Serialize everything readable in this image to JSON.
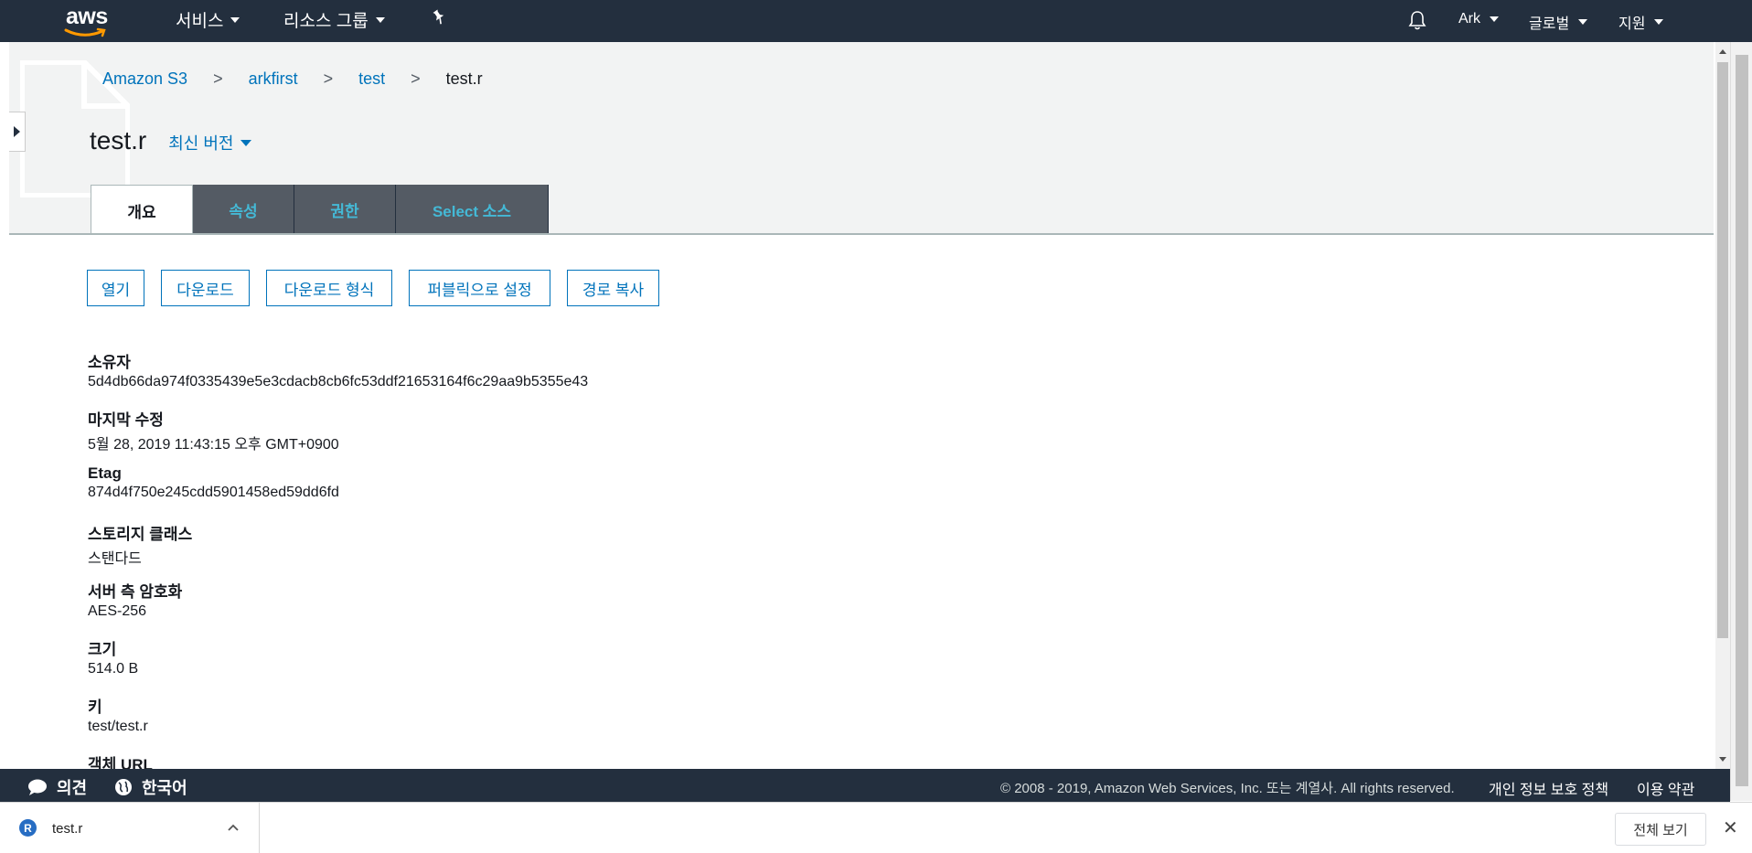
{
  "topnav": {
    "logo_text": "aws",
    "services": "서비스",
    "resource_groups": "리소스 그룹",
    "account": "Ark",
    "region": "글로벌",
    "support": "지원"
  },
  "breadcrumb": {
    "items": [
      "Amazon S3",
      "arkfirst",
      "test"
    ],
    "current": "test.r",
    "separator": ">"
  },
  "object": {
    "title": "test.r",
    "version_label": "최신 버전"
  },
  "tabs": [
    {
      "label": "개요",
      "active": true
    },
    {
      "label": "속성",
      "active": false
    },
    {
      "label": "권한",
      "active": false
    },
    {
      "label": "Select 소스",
      "active": false
    }
  ],
  "actions": {
    "open": "열기",
    "download": "다운로드",
    "download_as": "다운로드 형식",
    "make_public": "퍼블릭으로 설정",
    "copy_path": "경로 복사"
  },
  "properties": [
    {
      "label": "소유자",
      "value": "5d4db66da974f0335439e5e3cdacb8cb6fc53ddf21653164f6c29aa9b5355e43"
    },
    {
      "label": "마지막 수정",
      "value": "5월 28, 2019 11:43:15 오후 GMT+0900"
    },
    {
      "label": "Etag",
      "value": "874d4f750e245cdd5901458ed59dd6fd"
    },
    {
      "label": "스토리지 클래스",
      "value": "스탠다드"
    },
    {
      "label": "서버 측 암호화",
      "value": "AES-256"
    },
    {
      "label": "크기",
      "value": "514.0 B"
    },
    {
      "label": "키",
      "value": "test/test.r"
    },
    {
      "label": "객체 URL",
      "value": ""
    }
  ],
  "footer": {
    "feedback": "의견",
    "language": "한국어",
    "copyright": "© 2008 - 2019, Amazon Web Services, Inc. 또는 계열사. All rights reserved.",
    "privacy": "개인 정보 보호 정책",
    "terms": "이용 약관"
  },
  "download_bar": {
    "file_name": "test.r",
    "file_icon_letter": "R",
    "show_all": "전체 보기",
    "close": "✕"
  },
  "colors": {
    "nav_bg": "#232f3e",
    "link": "#0073bb",
    "tab_inactive_bg": "#545b64",
    "tab_inactive_text": "#44b9d6"
  }
}
